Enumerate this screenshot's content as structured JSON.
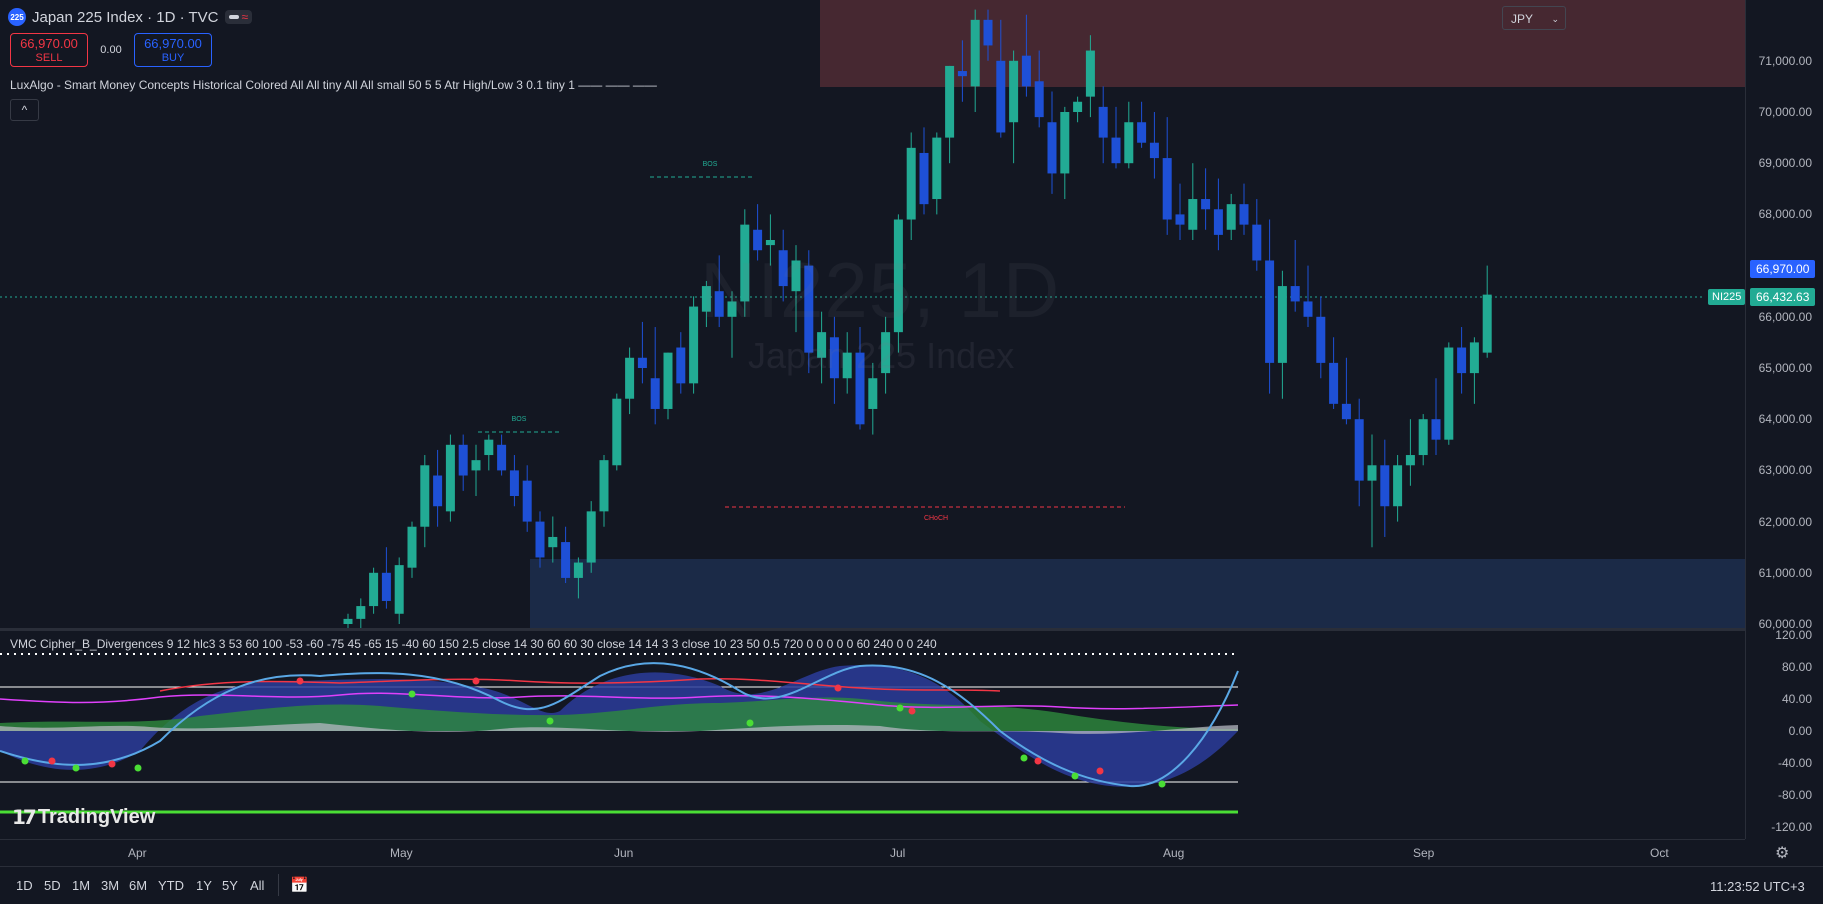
{
  "header": {
    "symbol_badge": "225",
    "title": "Japan 225 Index · 1D · TVC"
  },
  "trade": {
    "sell_price": "66,970.00",
    "sell_label": "SELL",
    "spread": "0.00",
    "buy_price": "66,970.00",
    "buy_label": "BUY"
  },
  "indicators": {
    "smc_legend": "LuxAlgo - Smart Money Concepts Historical Colored All All tiny All All small 50 5 5 Atr High/Low 3 0.1 tiny 1 —— —— ——",
    "collapse_label": "^",
    "vmc_legend": "VMC Cipher_B_Divergences 9 12 hlc3 3 53 60 100 -53 -60 -75 45 -65 15 -40 60 150 2.5 close 14 30 60 60 30 close 14 14 3 3 close 10 23 50 0.5 720 0 0 0 0 0 60 240 0 0 240"
  },
  "watermark": {
    "symbol": "NI225, 1D",
    "name": "Japan 225 Index"
  },
  "currency": "JPY",
  "price_axis": {
    "ticks": [
      "71,000.00",
      "70,000.00",
      "69,000.00",
      "68,000.00",
      "66,000.00",
      "65,000.00",
      "64,000.00",
      "63,000.00",
      "62,000.00",
      "61,000.00",
      "60,000.00"
    ],
    "current_price_tag": "66,970.00",
    "last_price_tag": "66,432.63",
    "last_symbol_tag": "NI225"
  },
  "indicator_axis": {
    "ticks": [
      "120.00",
      "80.00",
      "40.00",
      "0.00",
      "-40.00",
      "-80.00",
      "-120.00"
    ]
  },
  "smc_labels": {
    "bos1": "BOS",
    "bos2": "BOS",
    "choch": "CHoCH"
  },
  "time_axis": {
    "labels": [
      "Apr",
      "May",
      "Jun",
      "Jul",
      "Aug",
      "Sep",
      "Oct"
    ]
  },
  "branding": "TradingView",
  "bottom_bar": {
    "ranges": [
      "1D",
      "5D",
      "1M",
      "3M",
      "6M",
      "YTD",
      "1Y",
      "5Y",
      "All"
    ],
    "clock": "11:23:52 UTC+3"
  },
  "colors": {
    "up": "#22ab94",
    "down": "#1e50d6",
    "sell": "#f23645",
    "buy": "#2962ff",
    "supply_zone": "#4d2a33",
    "demand_zone": "#1b2b4a"
  },
  "chart_data": {
    "type": "candlestick",
    "x_labels": [
      "Apr",
      "May",
      "Jun",
      "Jul",
      "Aug",
      "Sep",
      "Oct"
    ],
    "ylim": [
      60000,
      72000
    ],
    "current_price": 66970,
    "last_price": 66432.63,
    "candles": [
      [
        60000,
        60200,
        59600,
        60100
      ],
      [
        60100,
        60500,
        59900,
        60350
      ],
      [
        60350,
        61100,
        60200,
        61000
      ],
      [
        61000,
        61500,
        60300,
        60450
      ],
      [
        60200,
        61300,
        60000,
        61150
      ],
      [
        61100,
        62000,
        60900,
        61900
      ],
      [
        61900,
        63300,
        61500,
        63100
      ],
      [
        62900,
        63400,
        61900,
        62300
      ],
      [
        62200,
        63700,
        62000,
        63500
      ],
      [
        63500,
        63700,
        62600,
        62900
      ],
      [
        63000,
        63500,
        62500,
        63200
      ],
      [
        63300,
        63700,
        63000,
        63600
      ],
      [
        63500,
        63700,
        62900,
        63000
      ],
      [
        63000,
        63300,
        62300,
        62500
      ],
      [
        62800,
        63100,
        61800,
        62000
      ],
      [
        62000,
        62200,
        61100,
        61300
      ],
      [
        61500,
        62100,
        61200,
        61700
      ],
      [
        61600,
        61900,
        60800,
        60900
      ],
      [
        60900,
        61300,
        60500,
        61200
      ],
      [
        61200,
        62400,
        61000,
        62200
      ],
      [
        62200,
        63300,
        61900,
        63200
      ],
      [
        63100,
        64500,
        63000,
        64400
      ],
      [
        64400,
        65400,
        64100,
        65200
      ],
      [
        65200,
        65900,
        64700,
        65000
      ],
      [
        64800,
        65800,
        63900,
        64200
      ],
      [
        64200,
        65300,
        64000,
        65300
      ],
      [
        65400,
        65700,
        64500,
        64700
      ],
      [
        64700,
        66400,
        64500,
        66200
      ],
      [
        66100,
        66700,
        65800,
        66600
      ],
      [
        66500,
        67200,
        65800,
        66000
      ],
      [
        66000,
        66500,
        65200,
        66300
      ],
      [
        66300,
        68100,
        66000,
        67800
      ],
      [
        67700,
        68200,
        67100,
        67300
      ],
      [
        67400,
        68000,
        67000,
        67500
      ],
      [
        67300,
        67700,
        66300,
        66600
      ],
      [
        66500,
        67400,
        65700,
        67100
      ],
      [
        67000,
        67300,
        64900,
        65300
      ],
      [
        65200,
        66100,
        64700,
        65700
      ],
      [
        65600,
        66000,
        64300,
        64800
      ],
      [
        64800,
        65700,
        64500,
        65300
      ],
      [
        65300,
        65800,
        63800,
        63900
      ],
      [
        64200,
        65100,
        63700,
        64800
      ],
      [
        64900,
        66000,
        64500,
        65700
      ],
      [
        65700,
        68000,
        65300,
        67900
      ],
      [
        67900,
        69600,
        67500,
        69300
      ],
      [
        69200,
        69700,
        68000,
        68200
      ],
      [
        68300,
        69600,
        68000,
        69500
      ],
      [
        69500,
        70900,
        69000,
        70900
      ],
      [
        70800,
        71400,
        70200,
        70700
      ],
      [
        70500,
        72000,
        70000,
        71800
      ],
      [
        71800,
        72000,
        71000,
        71300
      ],
      [
        71000,
        71800,
        69500,
        69600
      ],
      [
        69800,
        71200,
        69000,
        71000
      ],
      [
        71100,
        71900,
        70300,
        70500
      ],
      [
        70600,
        71200,
        69700,
        69900
      ],
      [
        69800,
        70400,
        68400,
        68800
      ],
      [
        68800,
        70100,
        68300,
        70000
      ],
      [
        70000,
        70300,
        69800,
        70200
      ],
      [
        70300,
        71500,
        69900,
        71200
      ],
      [
        70100,
        70500,
        69000,
        69500
      ],
      [
        69500,
        70100,
        68900,
        69000
      ],
      [
        69000,
        70200,
        68900,
        69800
      ],
      [
        69800,
        70200,
        69300,
        69400
      ],
      [
        69400,
        70000,
        68700,
        69100
      ],
      [
        69100,
        69900,
        67600,
        67900
      ],
      [
        68000,
        68600,
        67500,
        67800
      ],
      [
        67700,
        69000,
        67500,
        68300
      ],
      [
        68300,
        68900,
        67700,
        68100
      ],
      [
        68100,
        68700,
        67300,
        67600
      ],
      [
        67700,
        68400,
        67500,
        68200
      ],
      [
        68200,
        68600,
        67600,
        67800
      ],
      [
        67800,
        68300,
        66900,
        67100
      ],
      [
        67100,
        67900,
        64500,
        65100
      ],
      [
        65100,
        66900,
        64400,
        66600
      ],
      [
        66600,
        67500,
        66100,
        66300
      ],
      [
        66300,
        67000,
        65800,
        66000
      ],
      [
        66000,
        66400,
        64800,
        65100
      ],
      [
        65100,
        65600,
        64200,
        64300
      ],
      [
        64300,
        65200,
        63900,
        64000
      ],
      [
        64000,
        64400,
        62300,
        62800
      ],
      [
        62800,
        63700,
        61500,
        63100
      ],
      [
        63100,
        63600,
        61700,
        62300
      ],
      [
        62300,
        63300,
        62000,
        63100
      ],
      [
        63100,
        64000,
        62700,
        63300
      ],
      [
        63300,
        64100,
        63100,
        64000
      ],
      [
        64000,
        64800,
        63300,
        63600
      ],
      [
        63600,
        65500,
        63500,
        65400
      ],
      [
        65400,
        65800,
        64500,
        64900
      ],
      [
        64900,
        65600,
        64300,
        65500
      ],
      [
        65300,
        67000,
        65200,
        66433
      ]
    ]
  }
}
